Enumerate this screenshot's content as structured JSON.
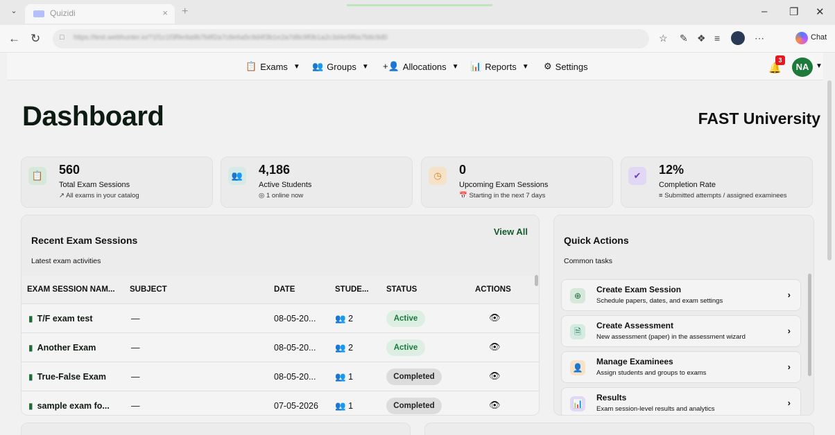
{
  "browser": {
    "tab_title": "Quizidi",
    "url": "https://test.webhunter.io/?1f1c1f3f9e9a9b7b8f2a7c8e6a5c9d4f3b1e2a7d8c9f0b1a2c3d4e5f6a7b8c9d0",
    "chat_label": "Chat"
  },
  "nav": {
    "items": [
      {
        "label": "Exams",
        "icon": "clipboard-icon"
      },
      {
        "label": "Groups",
        "icon": "users-icon"
      },
      {
        "label": "Allocations",
        "icon": "user-plus-icon"
      },
      {
        "label": "Reports",
        "icon": "chart-icon"
      },
      {
        "label": "Settings",
        "icon": "gear-icon"
      }
    ],
    "notifications": "3",
    "user_initials": "NA"
  },
  "page": {
    "title": "Dashboard",
    "org": "FAST University"
  },
  "stats": [
    {
      "value": "560",
      "label": "Total Exam Sessions",
      "sub": "All exams in your catalog",
      "icon": "clipboard-icon",
      "color": "#1e6b36",
      "bg": "#d5e8da"
    },
    {
      "value": "4,186",
      "label": "Active Students",
      "sub": "1 online now",
      "icon": "users-icon",
      "color": "#1f7a70",
      "bg": "#d6ebe7"
    },
    {
      "value": "0",
      "label": "Upcoming Exam Sessions",
      "sub": "Starting in the next 7 days",
      "icon": "clock-icon",
      "color": "#d9822b",
      "bg": "#f5e2c9"
    },
    {
      "value": "12%",
      "label": "Completion Rate",
      "sub": "Submitted attempts / assigned examinees",
      "icon": "check-circle-icon",
      "color": "#6a3fc6",
      "bg": "#e2d8f5"
    }
  ],
  "recent": {
    "title": "Recent Exam Sessions",
    "subtitle": "Latest exam activities",
    "view_all": "View All",
    "columns": [
      "EXAM SESSION NAM...",
      "SUBJECT",
      "DATE",
      "STUDE...",
      "STATUS",
      "ACTIONS"
    ],
    "rows": [
      {
        "name": "T/F exam test",
        "subject": "—",
        "date": "08-05-20...",
        "students": "2",
        "status": "Active"
      },
      {
        "name": "Another Exam",
        "subject": "—",
        "date": "08-05-20...",
        "students": "2",
        "status": "Active"
      },
      {
        "name": "True-False Exam",
        "subject": "—",
        "date": "08-05-20...",
        "students": "1",
        "status": "Completed"
      },
      {
        "name": "sample exam fo...",
        "subject": "—",
        "date": "07-05-2026",
        "students": "1",
        "status": "Completed"
      }
    ]
  },
  "quick": {
    "title": "Quick Actions",
    "subtitle": "Common tasks",
    "items": [
      {
        "title": "Create Exam Session",
        "desc": "Schedule papers, dates, and exam settings",
        "icon": "plus-circle-icon",
        "color": "#1e6b36",
        "bg": "#d5e8da"
      },
      {
        "title": "Create Assessment",
        "desc": "New assessment (paper) in the assessment wizard",
        "icon": "document-icon",
        "color": "#1f7a56",
        "bg": "#d3ebe0"
      },
      {
        "title": "Manage Examinees",
        "desc": "Assign students and groups to exams",
        "icon": "user-plus-icon",
        "color": "#d9822b",
        "bg": "#f5e2c9"
      },
      {
        "title": "Results",
        "desc": "Exam session-level results and analytics",
        "icon": "chart-icon",
        "color": "#6a3fc6",
        "bg": "#e2d8f5"
      }
    ]
  }
}
